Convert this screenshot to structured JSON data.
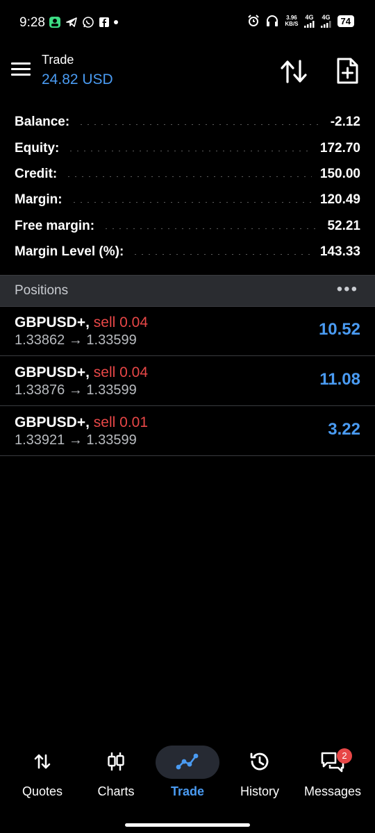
{
  "status_bar": {
    "time": "9:28",
    "speed_value": "3.96",
    "speed_unit": "KB/S",
    "net1": "4G",
    "net2": "4G",
    "battery": "74"
  },
  "app_bar": {
    "title": "Trade",
    "subtitle": "24.82 USD"
  },
  "summary": [
    {
      "label": "Balance:",
      "value": "-2.12"
    },
    {
      "label": "Equity:",
      "value": "172.70"
    },
    {
      "label": "Credit:",
      "value": "150.00"
    },
    {
      "label": "Margin:",
      "value": "120.49"
    },
    {
      "label": "Free margin:",
      "value": "52.21"
    },
    {
      "label": "Margin Level (%):",
      "value": "143.33"
    }
  ],
  "positions": {
    "header": "Positions",
    "more": "•••",
    "items": [
      {
        "symbol": "GBPUSD+,",
        "side": "sell 0.04",
        "prices": "1.33862 → 1.33599",
        "profit": "10.52"
      },
      {
        "symbol": "GBPUSD+,",
        "side": "sell 0.04",
        "prices": "1.33876 → 1.33599",
        "profit": "11.08"
      },
      {
        "symbol": "GBPUSD+,",
        "side": "sell 0.01",
        "prices": "1.33921 → 1.33599",
        "profit": "3.22"
      }
    ]
  },
  "bottom_nav": {
    "items": [
      {
        "label": "Quotes",
        "icon": "quotes-icon"
      },
      {
        "label": "Charts",
        "icon": "charts-icon"
      },
      {
        "label": "Trade",
        "icon": "trade-icon",
        "active": true
      },
      {
        "label": "History",
        "icon": "history-icon"
      },
      {
        "label": "Messages",
        "icon": "messages-icon",
        "badge": "2"
      }
    ]
  },
  "colors": {
    "accent": "#4a9bf2",
    "sell": "#e84747",
    "background": "#000000"
  }
}
